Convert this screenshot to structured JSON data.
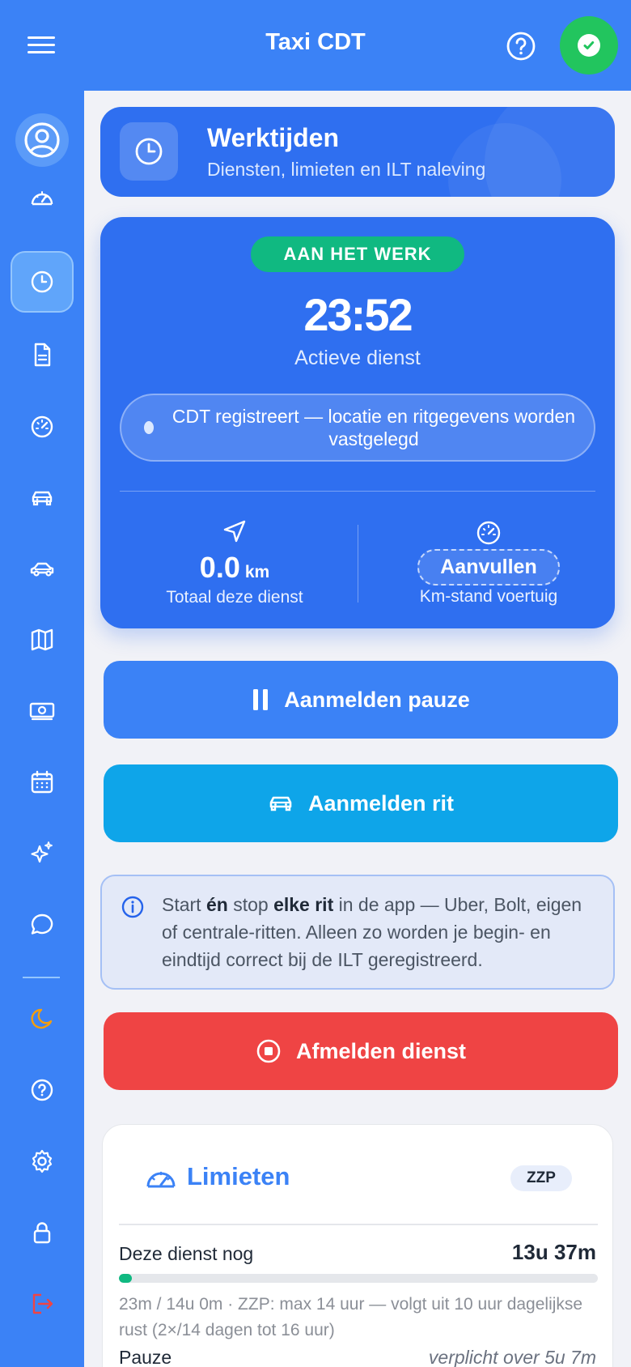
{
  "topbar": {
    "title": "Taxi CDT"
  },
  "page_header": {
    "title": "Werktijden",
    "subtitle": "Diensten, limieten en ILT naleving"
  },
  "work_status": {
    "badge": "AAN HET WERK",
    "time": "23:52",
    "label": "Actieve dienst",
    "recording_text": "CDT registreert — locatie en ritgegevens worden vastgelegd",
    "distance_value": "0.0",
    "distance_unit": "km",
    "distance_label": "Totaal deze dienst",
    "odometer_button": "Aanvullen",
    "odometer_label": "Km-stand voertuig"
  },
  "buttons": {
    "pause": "Aanmelden pauze",
    "ride": "Aanmelden rit",
    "stop": "Afmelden dienst"
  },
  "info": {
    "part1": "Start ",
    "bold1": "én",
    "part2": " stop ",
    "bold2": "elke rit",
    "part3": " in de app — Uber, Bolt, eigen of centrale-ritten. Alleen zo worden je begin- en eindtijd correct bij de ILT geregistreerd."
  },
  "limits": {
    "title": "Limieten",
    "badge": "ZZP",
    "shift_label": "Deze dienst nog",
    "shift_value": "13u 37m",
    "shift_progress": 0.027,
    "shift_note": "23m / 14u 0m · ZZP: max 14 uur — volgt uit 10 uur dagelijkse rust (2×/14 dagen tot 16 uur)",
    "pause_label": "Pauze",
    "pause_value": "verplicht over 5u 7m"
  },
  "colors": {
    "primary": "#3b82f6",
    "success": "#10b981",
    "ride": "#0ea5e9",
    "danger": "#ef4444",
    "moon": "#f59e0b",
    "logout": "#ef4444"
  },
  "sidebar_icons": [
    "user-icon",
    "dashboard-icon",
    "clock-icon",
    "document-icon",
    "speedometer-icon",
    "car-icon",
    "taxi-icon",
    "map-icon",
    "money-icon",
    "calendar-icon",
    "sparkles-icon",
    "chat-icon",
    "moon-icon",
    "help-icon",
    "settings-icon",
    "lock-icon",
    "logout-icon"
  ]
}
